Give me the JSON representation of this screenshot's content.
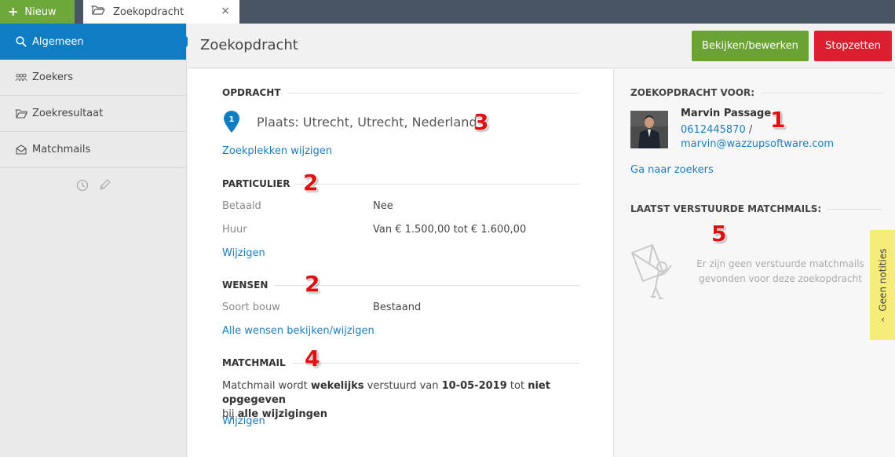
{
  "topbar": {
    "new_label": "Nieuw",
    "tab_label": "Zoekopdracht",
    "tab_close": "×"
  },
  "sidebar": {
    "items": [
      {
        "label": "Algemeen",
        "icon": "search-icon"
      },
      {
        "label": "Zoekers",
        "icon": "users-icon"
      },
      {
        "label": "Zoekresultaat",
        "icon": "folder-icon"
      },
      {
        "label": "Matchmails",
        "icon": "envelope-icon"
      }
    ]
  },
  "header": {
    "title": "Zoekopdracht",
    "edit_label": "Bekijken/bewerken",
    "stop_label": "Stopzetten"
  },
  "opdracht": {
    "heading": "OPDRACHT",
    "pin_number": "1",
    "place": "Plaats: Utrecht, Utrecht, Nederland",
    "change_link": "Zoekplekken wijzigen",
    "annotation": "3"
  },
  "particulier": {
    "heading": "PARTICULIER",
    "annotation": "2",
    "rows": [
      {
        "label": "Betaald",
        "value": "Nee"
      },
      {
        "label": "Huur",
        "value": "Van € 1.500,00 tot € 1.600,00"
      }
    ],
    "change_link": "Wijzigen"
  },
  "wensen": {
    "heading": "WENSEN",
    "annotation": "2",
    "rows": [
      {
        "label": "Soort bouw",
        "value": "Bestaand"
      }
    ],
    "change_link": "Alle wensen bekijken/wijzigen"
  },
  "matchmail": {
    "heading": "MATCHMAIL",
    "annotation": "4",
    "text_1": "Matchmail wordt ",
    "freq": "wekelijks",
    "text_2": " verstuurd van ",
    "start": "10-05-2019",
    "text_3": " tot ",
    "end": "niet opgegeven",
    "text_4": "bij ",
    "scope": "alle wijzigingen",
    "change_link": "Wijzigen"
  },
  "right": {
    "for_heading": "ZOEKOPDRACHT VOOR:",
    "annotation_1": "1",
    "name": "Marvin Passage",
    "phone": "0612445870",
    "phone_sep": " /",
    "email": "marvin@wazzupsoftware.com",
    "goto_link": "Ga naar zoekers",
    "mails_heading": "LAATST VERSTUURDE MATCHMAILS:",
    "annotation_5": "5",
    "empty_message": "Er zijn geen verstuurde matchmails gevonden voor deze zoekopdracht"
  },
  "notes": {
    "label": "Geen notities"
  },
  "colors": {
    "accent_blue": "#0e7dc2",
    "green": "#6aa334",
    "red": "#dc1f2e",
    "notes_yellow": "#f6ec7a",
    "annotation_red": "#e01010"
  }
}
